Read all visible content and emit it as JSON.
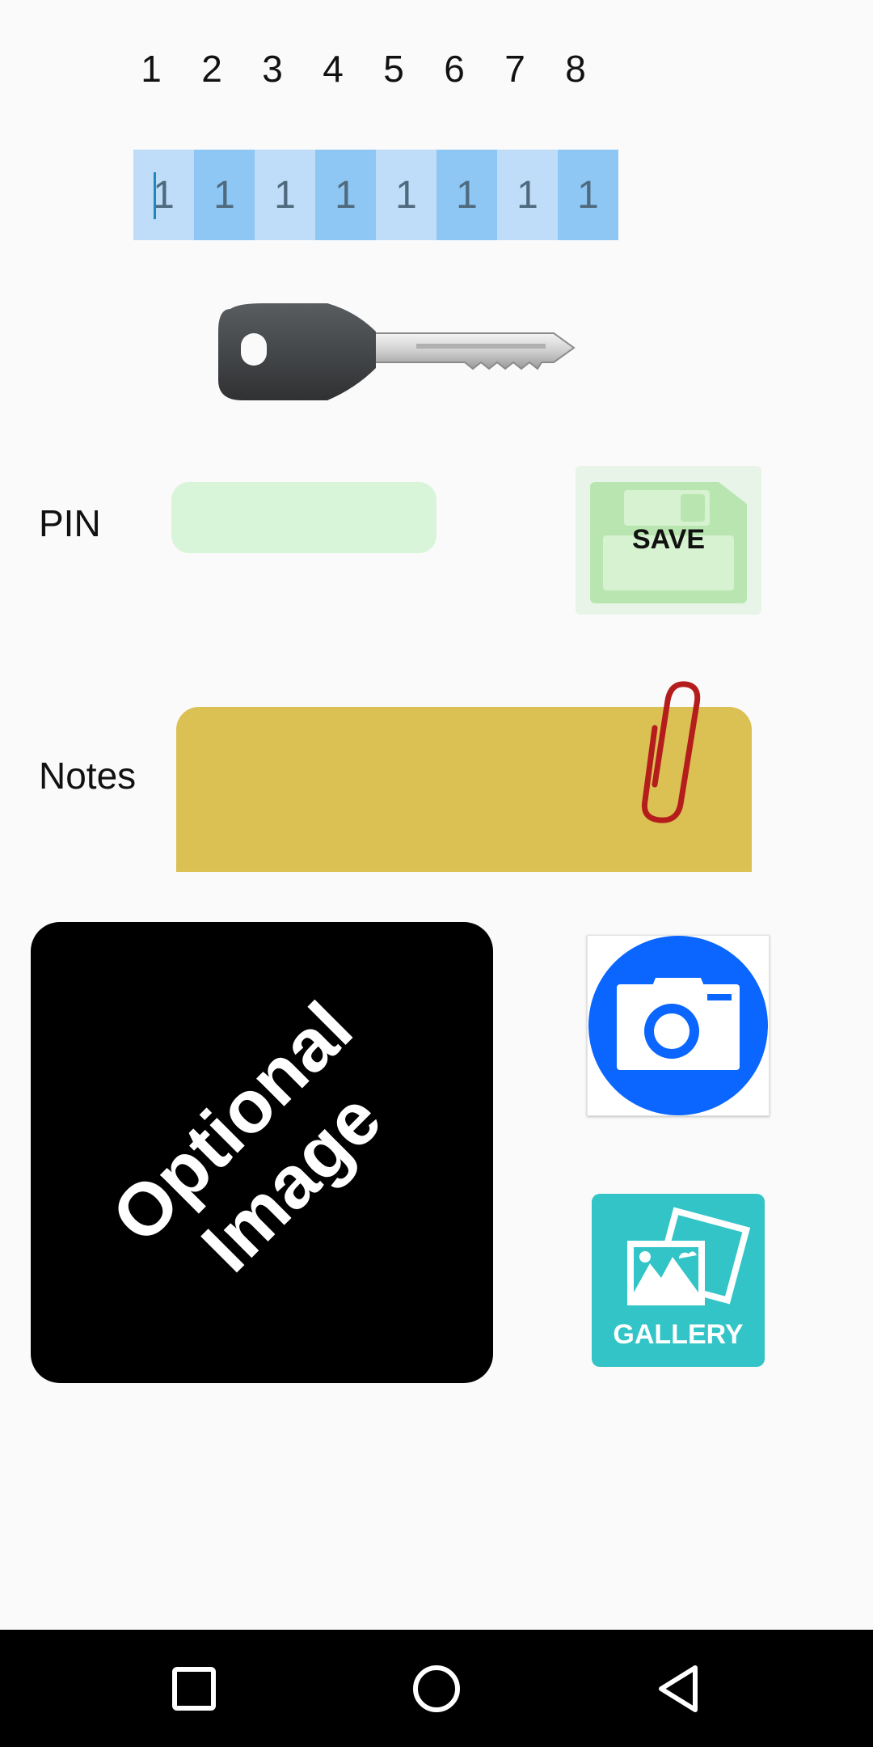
{
  "header_numbers": [
    "1",
    "2",
    "3",
    "4",
    "5",
    "6",
    "7",
    "8"
  ],
  "digit_cells": [
    "1",
    "1",
    "1",
    "1",
    "1",
    "1",
    "1",
    "1"
  ],
  "pin": {
    "label": "PIN",
    "value": "",
    "placeholder": ""
  },
  "save_button": {
    "label": "SAVE"
  },
  "notes": {
    "label": "Notes",
    "value": ""
  },
  "optional_image": {
    "line1": "Optional",
    "line2": "Image"
  },
  "gallery_button": {
    "label": "GALLERY"
  },
  "icons": {
    "key": "key-icon",
    "save": "floppy-disk-icon",
    "paperclip": "paperclip-icon",
    "camera": "camera-icon",
    "gallery": "gallery-icon",
    "nav_recents": "square-icon",
    "nav_home": "circle-icon",
    "nav_back": "triangle-back-icon"
  },
  "colors": {
    "cell_light": "#bfdcf8",
    "cell_dark": "#8ec7f4",
    "pin_field": "#d8f5da",
    "notes_bg": "#dbc053",
    "camera_blue": "#0a66ff",
    "gallery_teal": "#33c4c7"
  }
}
